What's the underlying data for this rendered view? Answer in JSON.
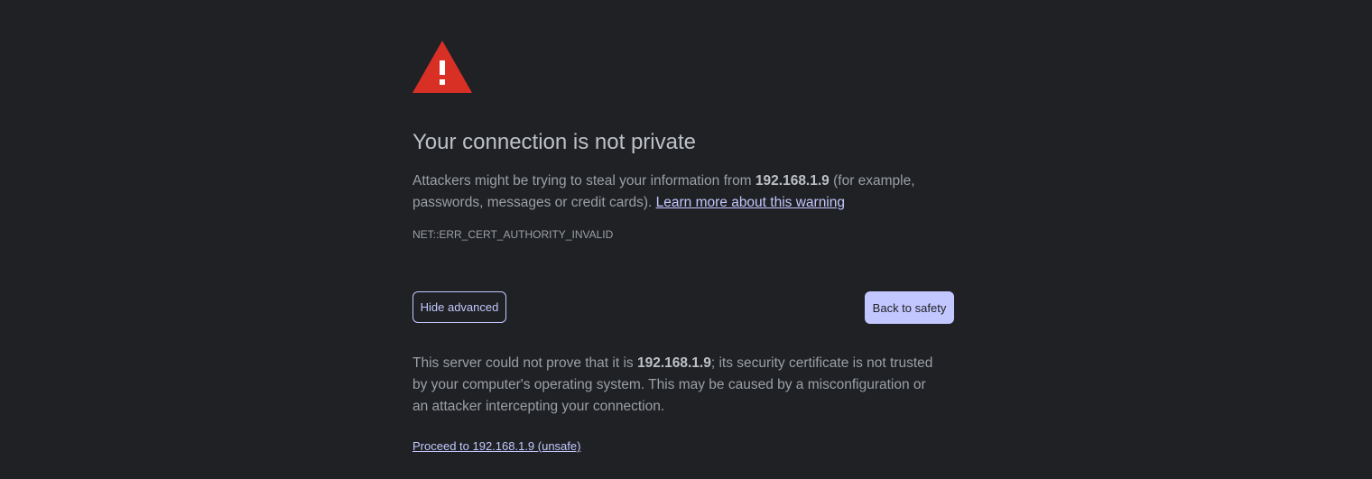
{
  "icon": {
    "name": "warning-triangle-icon",
    "color": "#d93025"
  },
  "heading": "Your connection is not private",
  "explanation": {
    "before": "Attackers might be trying to steal your information from ",
    "host": "192.168.1.9",
    "after": " (for example, passwords, messages or credit cards). ",
    "learn_more": "Learn more about this warning"
  },
  "error_code": "NET::ERR_CERT_AUTHORITY_INVALID",
  "buttons": {
    "hide_advanced": "Hide advanced",
    "back_to_safety": "Back to safety"
  },
  "details": {
    "before": "This server could not prove that it is ",
    "host": "192.168.1.9",
    "after": "; its security certificate is not trusted by your computer's operating system. This may be caused by a misconfiguration or an attacker intercepting your connection."
  },
  "proceed_link": "Proceed to 192.168.1.9 (unsafe)",
  "colors": {
    "background": "#202124",
    "text": "#9aa0a6",
    "heading": "#bdc1c6",
    "accent": "#c2c8ff",
    "danger": "#d93025"
  }
}
